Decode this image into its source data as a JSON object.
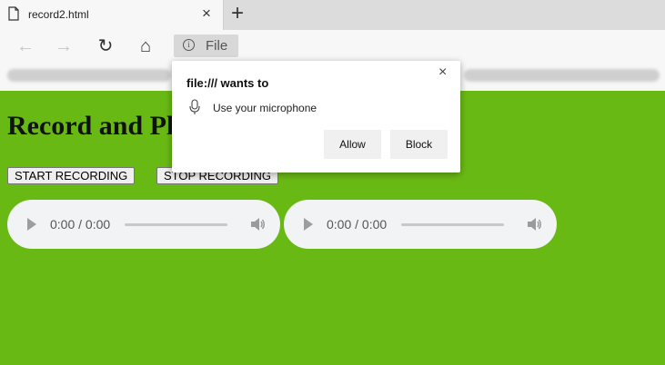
{
  "browser": {
    "tab": {
      "title": "record2.html",
      "close_glyph": "×",
      "icon": "document-icon"
    },
    "new_tab_glyph": "+",
    "toolbar": {
      "back_glyph": "←",
      "forward_glyph": "→",
      "reload_glyph": "↻",
      "home_glyph": "⌂",
      "site_chip_label": "File",
      "info_glyph": "i"
    }
  },
  "page": {
    "heading": "Record and Play Audio in JavaScript",
    "start_label": "START RECORDING",
    "stop_label": "STOP RECORDING",
    "players": [
      {
        "time": "0:00 / 0:00"
      },
      {
        "time": "0:00 / 0:00"
      }
    ],
    "background_color": "#69b915"
  },
  "permission_popup": {
    "title": "file:/// wants to",
    "close_glyph": "×",
    "permission_text": "Use your microphone",
    "allow_label": "Allow",
    "block_label": "Block"
  }
}
